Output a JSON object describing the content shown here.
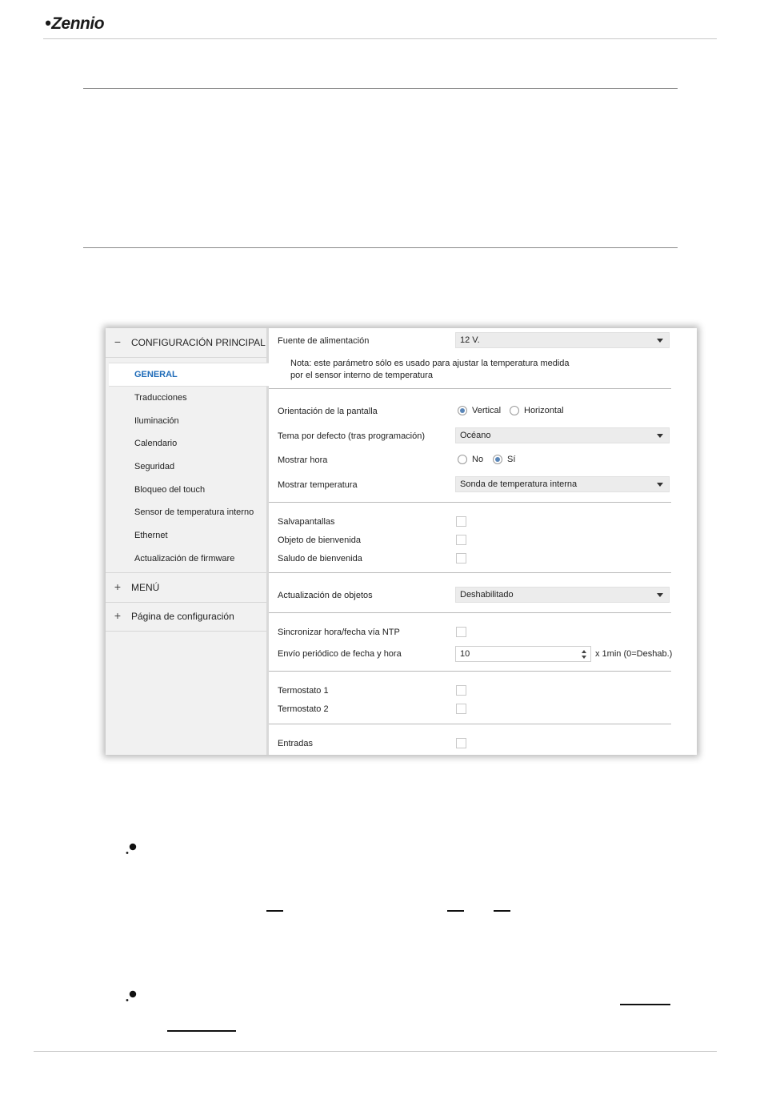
{
  "header": {
    "logo_text": "Zennio"
  },
  "sidebar": {
    "group_main": {
      "sign": "−",
      "label": "CONFIGURACIÓN PRINCIPAL"
    },
    "items": [
      {
        "label": "GENERAL",
        "active": true
      },
      {
        "label": "Traducciones"
      },
      {
        "label": "Iluminación"
      },
      {
        "label": "Calendario"
      },
      {
        "label": "Seguridad"
      },
      {
        "label": "Bloqueo del touch"
      },
      {
        "label": "Sensor de temperatura interno"
      },
      {
        "label": "Ethernet"
      },
      {
        "label": "Actualización de firmware"
      }
    ],
    "group_menu": {
      "sign": "+",
      "label": "MENÚ"
    },
    "group_config": {
      "sign": "+",
      "label": "Página de configuración"
    }
  },
  "params": {
    "power_supply": {
      "label": "Fuente de alimentación",
      "value": "12 V."
    },
    "note": {
      "line1": "Nota: este parámetro sólo es usado para ajustar la temperatura medida",
      "line2": "por el sensor interno de temperatura"
    },
    "orientation": {
      "label": "Orientación de la pantalla",
      "options": [
        "Vertical",
        "Horizontal"
      ],
      "selected": "Vertical"
    },
    "default_theme": {
      "label": "Tema por defecto (tras programación)",
      "value": "Océano"
    },
    "show_time": {
      "label": "Mostrar hora",
      "options": [
        "No",
        "Sí"
      ],
      "selected": "Sí"
    },
    "show_temperature": {
      "label": "Mostrar temperatura",
      "value": "Sonda de temperatura interna"
    },
    "screensaver": {
      "label": "Salvapantallas",
      "checked": false
    },
    "welcome_object": {
      "label": "Objeto de bienvenida",
      "checked": false
    },
    "welcome_greeting": {
      "label": "Saludo de bienvenida",
      "checked": false
    },
    "object_update": {
      "label": "Actualización de objetos",
      "value": "Deshabilitado"
    },
    "ntp_sync": {
      "label": "Sincronizar hora/fecha vía NTP",
      "checked": false
    },
    "periodic_send": {
      "label": "Envío periódico de fecha y hora",
      "value": "10",
      "unit": "x 1min (0=Deshab.)"
    },
    "thermostat1": {
      "label": "Termostato 1",
      "checked": false
    },
    "thermostat2": {
      "label": "Termostato 2",
      "checked": false
    },
    "inputs": {
      "label": "Entradas",
      "checked": false
    }
  }
}
